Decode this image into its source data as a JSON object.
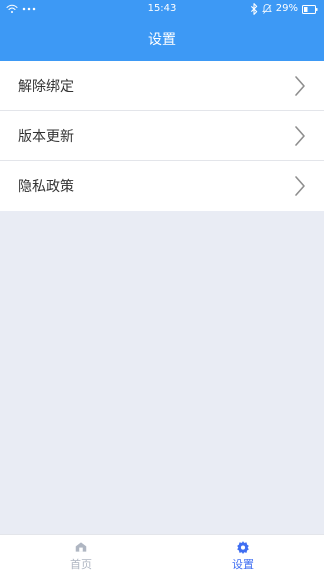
{
  "status_bar": {
    "time": "15:43",
    "battery": "29%"
  },
  "header": {
    "title": "设置"
  },
  "settings": {
    "items": [
      {
        "label": "解除绑定"
      },
      {
        "label": "版本更新"
      },
      {
        "label": "隐私政策"
      }
    ]
  },
  "tabbar": {
    "home_label": "首页",
    "settings_label": "设置"
  },
  "colors": {
    "header_bg": "#3D99F5",
    "page_bg": "#E9ECF4",
    "active_tab": "#3F6EF2",
    "inactive_tab": "#AFB6C2"
  },
  "icons": {
    "status_left": [
      "wifi-icon",
      "more-dots-icon"
    ],
    "status_right": [
      "bluetooth-icon",
      "mute-bell-icon",
      "battery-icon"
    ],
    "row_chevron": "chevron-right-icon",
    "tab_home": "home-icon",
    "tab_settings": "gear-icon"
  }
}
